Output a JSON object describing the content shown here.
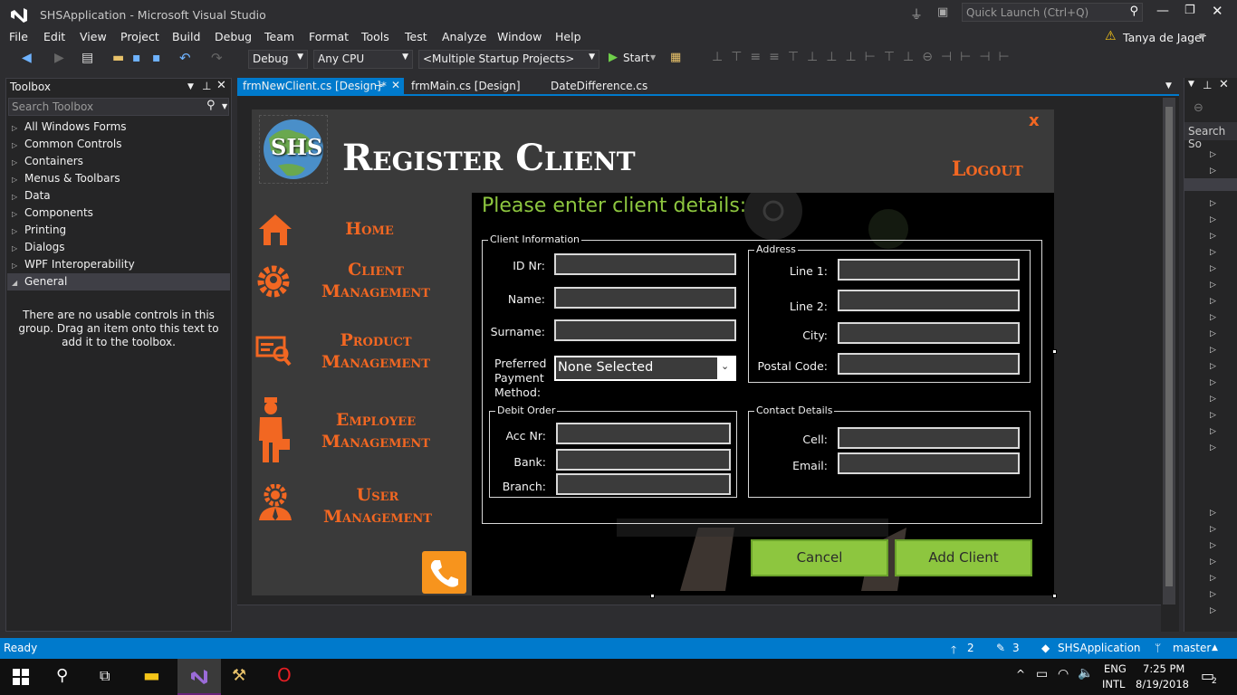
{
  "window": {
    "title": "SHSApplication - Microsoft Visual Studio",
    "quick_launch": "Quick Launch (Ctrl+Q)",
    "user": "Tanya de Jager"
  },
  "menu": [
    "File",
    "Edit",
    "View",
    "Project",
    "Build",
    "Debug",
    "Team",
    "Format",
    "Tools",
    "Test",
    "Analyze",
    "Window",
    "Help"
  ],
  "toolbar": {
    "config": "Debug",
    "platform": "Any CPU",
    "startup": "<Multiple Startup Projects>",
    "start": "Start"
  },
  "toolbox": {
    "title": "Toolbox",
    "search_placeholder": "Search Toolbox",
    "items": [
      "All Windows Forms",
      "Common Controls",
      "Containers",
      "Menus & Toolbars",
      "Data",
      "Components",
      "Printing",
      "Dialogs",
      "WPF Interoperability",
      "General"
    ],
    "empty_message": "There are no usable controls in this group. Drag an item onto this text to add it to the toolbox."
  },
  "tabs": [
    "frmNewClient.cs [Design]*",
    "frmMain.cs [Design]",
    "DateDifference.cs"
  ],
  "form": {
    "logo_text": "SHS",
    "title": "Register Client",
    "close": "x",
    "logout": "Logout",
    "nav": [
      {
        "label_1": "Home",
        "label_2": ""
      },
      {
        "label_1": "Client",
        "label_2": "Management"
      },
      {
        "label_1": "Product",
        "label_2": "Management"
      },
      {
        "label_1": "Employee",
        "label_2": "Management"
      },
      {
        "label_1": "User",
        "label_2": "Management"
      }
    ],
    "prompt": "Please enter client details:",
    "client_info": {
      "title": "Client Information",
      "id_label": "ID Nr:",
      "name_label": "Name:",
      "surname_label": "Surname:",
      "payment_label_1": "Preferred",
      "payment_label_2": "Payment",
      "payment_label_3": "Method:",
      "payment_value": "None Selected"
    },
    "address": {
      "title": "Address",
      "line1_label": "Line 1:",
      "line2_label": "Line 2:",
      "city_label": "City:",
      "postal_label": "Postal Code:"
    },
    "debit": {
      "title": "Debit Order",
      "acc_label": "Acc Nr:",
      "bank_label": "Bank:",
      "branch_label": "Branch:"
    },
    "contact": {
      "title": "Contact Details",
      "cell_label": "Cell:",
      "email_label": "Email:"
    },
    "cancel": "Cancel",
    "add": "Add Client"
  },
  "right_panel": {
    "search": "Search So"
  },
  "status": {
    "ready": "Ready",
    "up": "2",
    "edits": "3",
    "repo": "SHSApplication",
    "branch": "master"
  },
  "taskbar": {
    "lang1": "ENG",
    "lang2": "INTL",
    "time": "7:25 PM",
    "date": "8/19/2018",
    "notif": "2"
  },
  "colors": {
    "accent": "#f26722",
    "green": "#8dc63f",
    "prompt": "#8dc63f",
    "vsblue": "#007acc"
  }
}
